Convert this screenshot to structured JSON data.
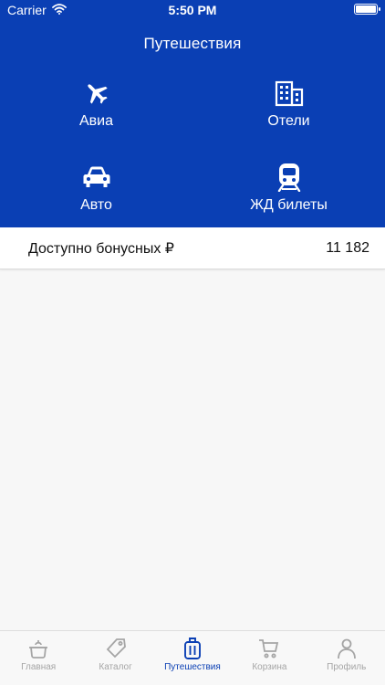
{
  "status_bar": {
    "carrier": "Carrier",
    "time": "5:50 PM"
  },
  "header": {
    "title": "Путешествия"
  },
  "tiles": [
    {
      "label": "Авиа",
      "icon": "airplane-icon"
    },
    {
      "label": "Отели",
      "icon": "hotel-building-icon"
    },
    {
      "label": "Авто",
      "icon": "car-icon"
    },
    {
      "label": "ЖД билеты",
      "icon": "train-icon"
    }
  ],
  "bonus": {
    "label": "Доступно бонусных ₽",
    "value": "11 182"
  },
  "tabbar": {
    "items": [
      {
        "label": "Главная",
        "icon": "home-pot-icon",
        "active": false
      },
      {
        "label": "Каталог",
        "icon": "tag-icon",
        "active": false
      },
      {
        "label": "Путешествия",
        "icon": "suitcase-icon",
        "active": true
      },
      {
        "label": "Корзина",
        "icon": "cart-icon",
        "active": false
      },
      {
        "label": "Профиль",
        "icon": "profile-icon",
        "active": false
      }
    ]
  },
  "colors": {
    "primary": "#0a3fb4",
    "inactive": "#a5a5a5",
    "background": "#f7f7f7"
  }
}
